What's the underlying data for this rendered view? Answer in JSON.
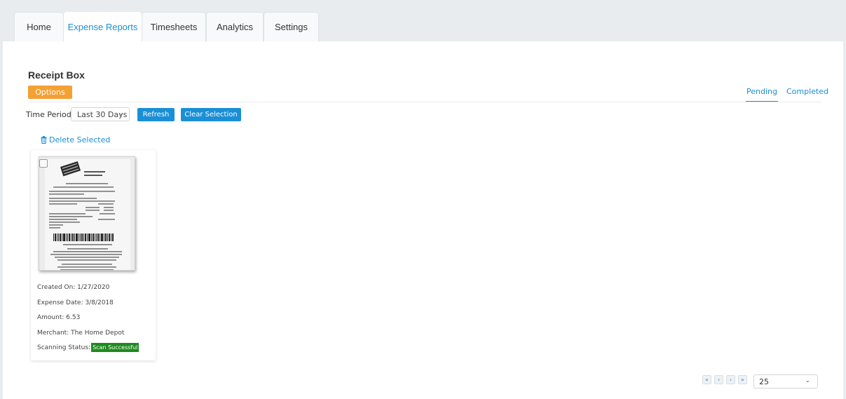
{
  "tabs": [
    {
      "label": "Home",
      "active": false
    },
    {
      "label": "Expense Reports",
      "active": true
    },
    {
      "label": "Timesheets",
      "active": false
    },
    {
      "label": "Analytics",
      "active": false
    },
    {
      "label": "Settings",
      "active": false
    }
  ],
  "page": {
    "title": "Receipt Box",
    "options_label": "Options",
    "status_tabs": [
      {
        "label": "Pending",
        "active": true
      },
      {
        "label": "Completed",
        "active": false
      }
    ]
  },
  "filters": {
    "time_period_label": "Time Period",
    "time_period_value": "Last 30 Days",
    "refresh_label": "Refresh",
    "clear_selection_label": "Clear Selection",
    "delete_selected_label": "Delete Selected"
  },
  "receipt_card": {
    "created_on": "Created On: 1/27/2020",
    "expense_date": "Expense Date: 3/8/2018",
    "amount": "Amount: 6.53",
    "merchant": "Merchant: The Home Depot",
    "scanning_status_label": "Scanning Status:",
    "scanning_status_value": "Scan Successful"
  },
  "pagination": {
    "first": "«",
    "prev": "‹",
    "next": "›",
    "last": "»",
    "page_size": "25"
  },
  "colors": {
    "accent_blue": "#1a8fd6",
    "options_orange": "#f5a033",
    "success_green": "#1e8a1e"
  }
}
